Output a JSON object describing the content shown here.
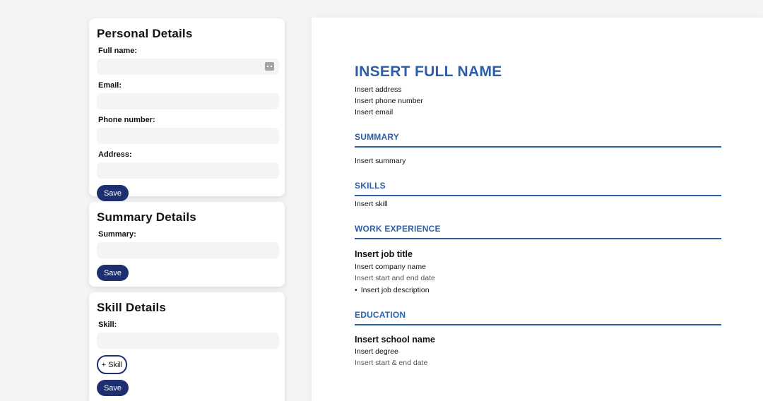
{
  "personal": {
    "title": "Personal Details",
    "full_name_label": "Full name:",
    "email_label": "Email:",
    "phone_label": "Phone number:",
    "address_label": "Address:",
    "save_label": "Save"
  },
  "summary_form": {
    "title": "Summary Details",
    "summary_label": "Summary:",
    "save_label": "Save"
  },
  "skill_form": {
    "title": "Skill Details",
    "skill_label": "Skill:",
    "add_skill_label": "+ Skill",
    "save_label": "Save"
  },
  "resume": {
    "name": "INSERT FULL NAME",
    "address": "Insert address",
    "phone": "Insert phone number",
    "email": "Insert email",
    "summary_heading": "SUMMARY",
    "summary_text": "Insert summary",
    "skills_heading": "SKILLS",
    "skill_text": "Insert skill",
    "work_heading": "WORK EXPERIENCE",
    "job_title": "Insert job title",
    "company": "Insert company name",
    "job_dates": "Insert start and end date",
    "job_description": "Insert job description",
    "education_heading": "EDUCATION",
    "school": "Insert school name",
    "degree": "Insert degree",
    "school_dates": "Insert start & end date"
  },
  "colors": {
    "accent_blue": "#2d5fa8",
    "button_navy": "#1e2f70",
    "page_bg": "#f3f4f6"
  }
}
